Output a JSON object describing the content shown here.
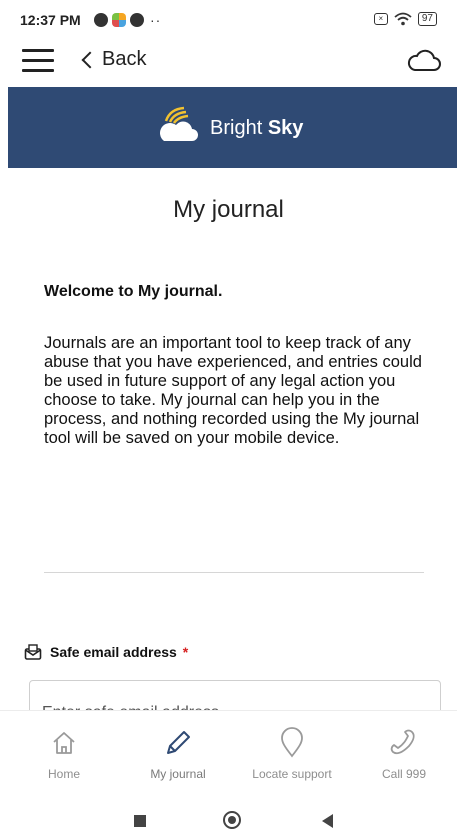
{
  "status_bar": {
    "time": "12:37 PM",
    "more": "··",
    "battery": "97"
  },
  "nav": {
    "back_label": "Back"
  },
  "brand": {
    "name_regular": "Bright ",
    "name_bold": "Sky",
    "color": "#2f4a74"
  },
  "page": {
    "title": "My journal",
    "welcome_heading": "Welcome to My journal.",
    "intro_text": "Journals are an important tool to keep track of any abuse that you have experienced, and entries could be used in future support of any legal action you choose to take.  My journal can help you in the process, and nothing recorded using the My journal tool will be saved on your mobile device."
  },
  "email": {
    "label": "Safe email address",
    "required_mark": "*",
    "placeholder": "Enter safe email address",
    "value": ""
  },
  "tabs": [
    {
      "label": "Home",
      "icon": "home-icon"
    },
    {
      "label": "My journal",
      "icon": "pencil-icon",
      "active": true
    },
    {
      "label": "Locate support",
      "icon": "location-pin-icon"
    },
    {
      "label": "Call 999",
      "icon": "phone-icon"
    }
  ]
}
